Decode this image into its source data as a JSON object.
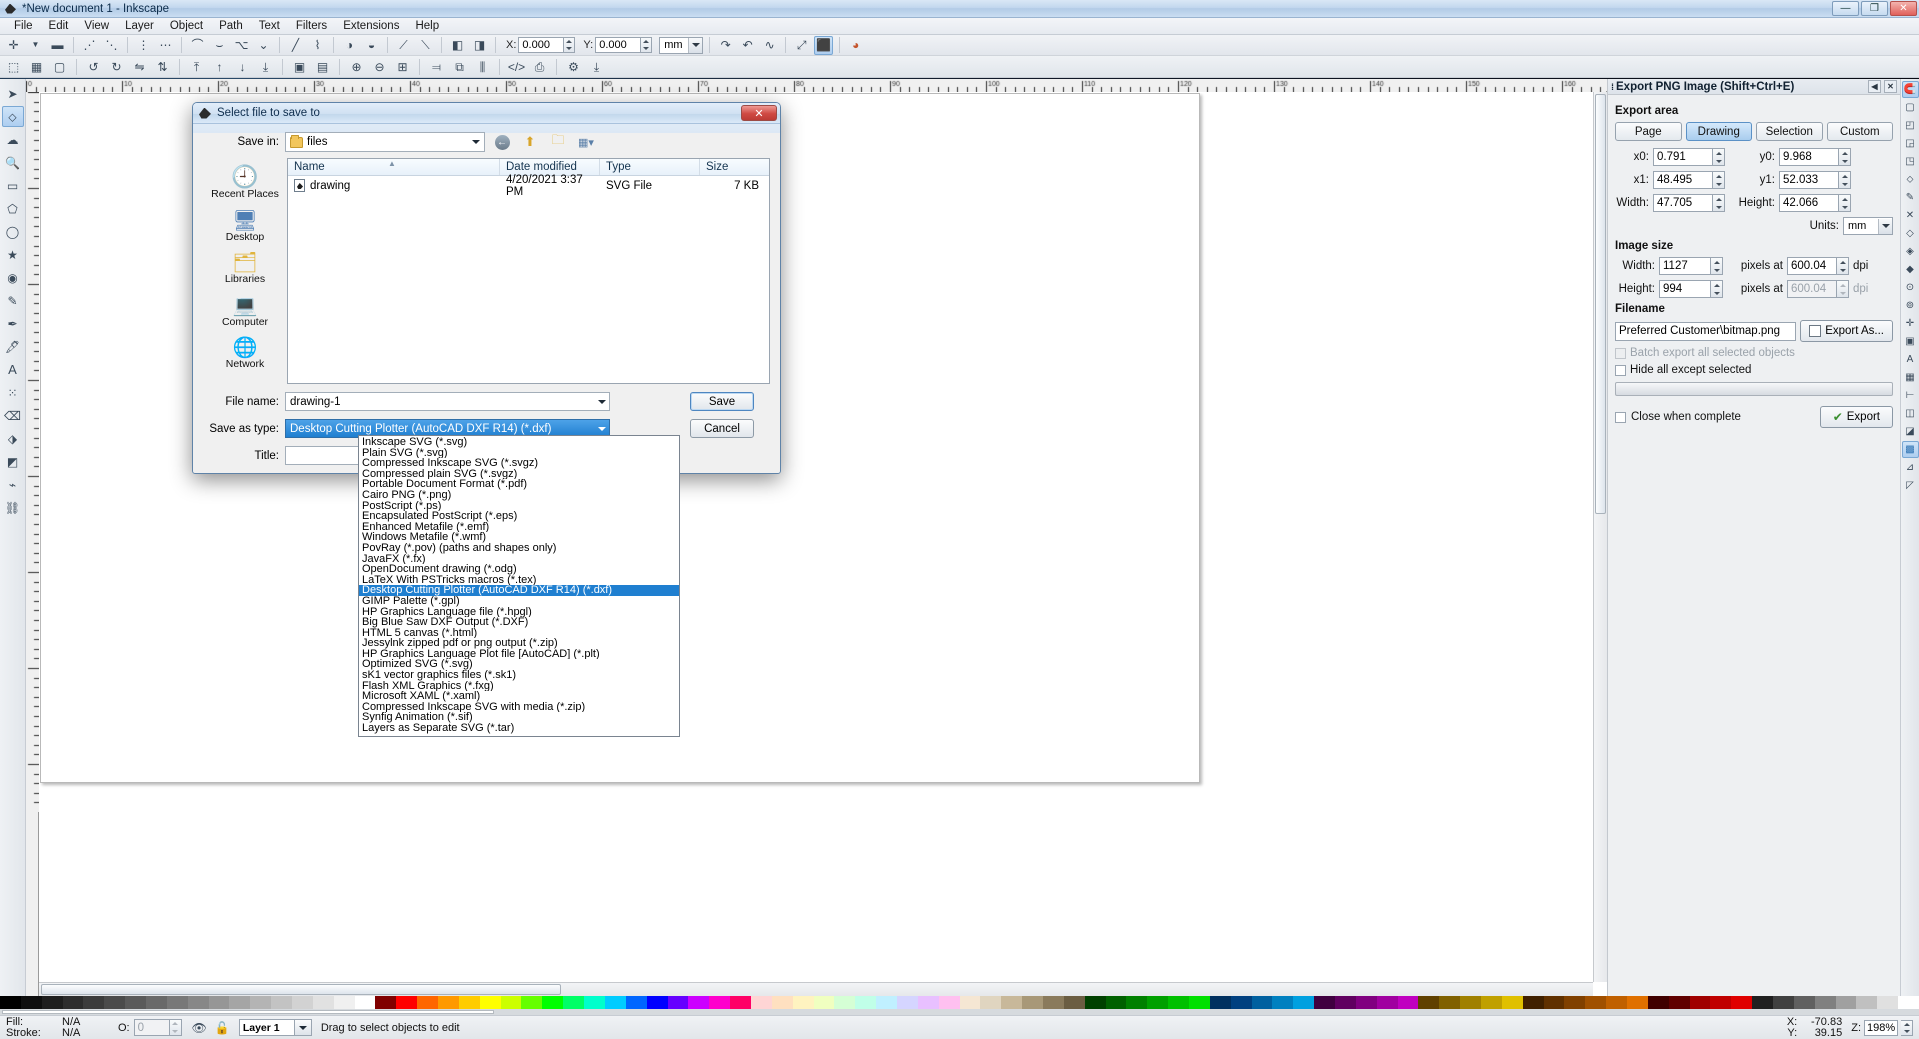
{
  "window": {
    "title": "*New document 1 - Inkscape",
    "buttons": {
      "minimize": "—",
      "maximize": "❐",
      "close": "✕"
    }
  },
  "menubar": [
    "File",
    "Edit",
    "View",
    "Layer",
    "Object",
    "Path",
    "Text",
    "Filters",
    "Extensions",
    "Help"
  ],
  "toolbar": {
    "x_label": "X:",
    "x_value": "0.000",
    "y_label": "Y:",
    "y_value": "0.000",
    "units_value": "mm"
  },
  "export_panel": {
    "header": "Export PNG Image (Shift+Ctrl+E)",
    "collapse_icon": "◀",
    "close_icon": "✕",
    "export_area": {
      "title": "Export area",
      "buttons": [
        {
          "label": "Page",
          "active": false
        },
        {
          "label": "Drawing",
          "active": true
        },
        {
          "label": "Selection",
          "active": false
        },
        {
          "label": "Custom",
          "active": false
        }
      ],
      "fields": [
        {
          "label": "x0:",
          "value": "0.791"
        },
        {
          "label": "y0:",
          "value": "9.968"
        },
        {
          "label": "x1:",
          "value": "48.495"
        },
        {
          "label": "y1:",
          "value": "52.033"
        },
        {
          "label": "Width:",
          "value": "47.705"
        },
        {
          "label": "Height:",
          "value": "42.066"
        }
      ],
      "units_label": "Units:",
      "units_value": "mm"
    },
    "image_size": {
      "title": "Image size",
      "width_label": "Width:",
      "width_value": "1127",
      "width_suffix": "pixels at",
      "width_dpi": "600.04",
      "dpi_label": "dpi",
      "height_label": "Height:",
      "height_value": "994",
      "height_suffix": "pixels at",
      "height_dpi": "600.04",
      "height_dpi_label": "dpi"
    },
    "filename": {
      "title": "Filename",
      "value": "Preferred Customer\\bitmap.png",
      "export_as_button": "Export As..."
    },
    "checkboxes": [
      {
        "label": "Batch export all selected objects",
        "checked": false,
        "disabled": true
      },
      {
        "label": "Hide all except selected",
        "checked": false,
        "disabled": false
      },
      {
        "label": "Close when complete",
        "checked": false,
        "disabled": false
      }
    ],
    "export_button": "Export"
  },
  "dialog": {
    "title": "Select file to save to",
    "close_label": "✕",
    "save_in_label": "Save in:",
    "save_in_value": "files",
    "nav_icons": [
      "back-icon",
      "up-folder-icon",
      "new-folder-icon",
      "view-mode-icon"
    ],
    "columns": [
      "Name",
      "Date modified",
      "Type",
      "Size"
    ],
    "files": [
      {
        "name": "drawing",
        "modified": "4/20/2021 3:37 PM",
        "type": "SVG File",
        "size": "7 KB"
      }
    ],
    "places": [
      "Recent Places",
      "Desktop",
      "Libraries",
      "Computer",
      "Network"
    ],
    "file_name_label": "File name:",
    "file_name_value": "drawing-1",
    "save_as_type_label": "Save as type:",
    "save_as_type_value": "Desktop Cutting Plotter (AutoCAD DXF R14) (*.dxf)",
    "title_label": "Title:",
    "title_value": "",
    "save_button": "Save",
    "cancel_button": "Cancel",
    "dropdown_options": [
      "Inkscape SVG (*.svg)",
      "Plain SVG (*.svg)",
      "Compressed Inkscape SVG (*.svgz)",
      "Compressed plain SVG (*.svgz)",
      "Portable Document Format (*.pdf)",
      "Cairo PNG (*.png)",
      "PostScript (*.ps)",
      "Encapsulated PostScript (*.eps)",
      "Enhanced Metafile (*.emf)",
      "Windows Metafile (*.wmf)",
      "PovRay (*.pov) (paths and shapes only)",
      "JavaFX (*.fx)",
      "OpenDocument drawing (*.odg)",
      "LaTeX With PSTricks macros (*.tex)",
      "Desktop Cutting Plotter (AutoCAD DXF R14) (*.dxf)",
      "GIMP Palette (*.gpl)",
      "HP Graphics Language file (*.hpgl)",
      "Big Blue Saw DXF Output (*.DXF)",
      "HTML 5 canvas (*.html)",
      "Jessylnk zipped pdf or png output (*.zip)",
      "HP Graphics Language Plot file [AutoCAD] (*.plt)",
      "Optimized SVG (*.svg)",
      "sK1 vector graphics files (*.sk1)",
      "Flash XML Graphics (*.fxg)",
      "Microsoft XAML (*.xaml)",
      "Compressed Inkscape SVG with media (*.zip)",
      "Synfig Animation (*.sif)",
      "Layers as Separate SVG (*.tar)"
    ],
    "selected_option_index": 14
  },
  "statusbar": {
    "fill_label": "Fill:",
    "fill_value": "N/A",
    "stroke_label": "Stroke:",
    "stroke_value": "N/A",
    "opacity_label": "O:",
    "opacity_value": "0",
    "layer_value": "Layer 1",
    "hint": "Drag to select objects to edit",
    "cursor_x_label": "X:",
    "cursor_x": "-70.83",
    "cursor_y_label": "Y:",
    "cursor_y": "39.15",
    "zoom_label": "Z:",
    "zoom_value": "198%"
  },
  "rulers": {
    "h_ticks": [
      "0",
      "10",
      "20",
      "30",
      "40",
      "50",
      "60",
      "70",
      "80",
      "90",
      "100",
      "110",
      "120"
    ],
    "v_ticks": [
      "0",
      "10",
      "20",
      "30",
      "40",
      "50",
      "60",
      "70"
    ]
  },
  "colors": {
    "accent": "#1f7fd0",
    "title_blue": "#0e2d4d",
    "panel_bg": "#eef0f2",
    "selection": "#1f7fd0"
  }
}
